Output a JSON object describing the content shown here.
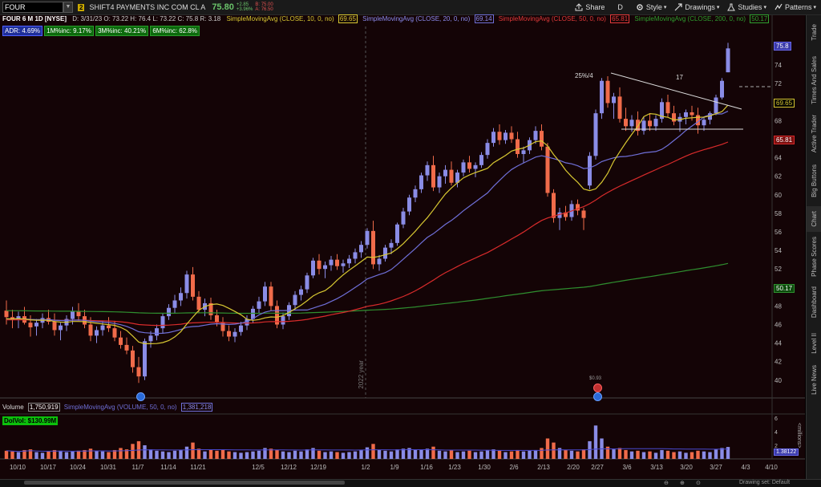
{
  "toolbar": {
    "symbol": "FOUR",
    "link_badge": "2",
    "company": "SHIFT4 PAYMENTS INC COM CL A",
    "last_price": "75.80",
    "change_top": "+2.85",
    "change_bottom": "+3.96%",
    "bid": "B: 75.00",
    "ask": "A: 76.50",
    "share_label": "Share",
    "period_label": "D",
    "style_label": "Style",
    "drawings_label": "Drawings",
    "studies_label": "Studies",
    "patterns_label": "Patterns"
  },
  "header": {
    "title": "FOUR 6 M 1D [NYSE]",
    "ohlc": "D: 3/31/23  O: 73.22  H: 76.4  L: 73.22  C: 75.8  R: 3.18",
    "sma10_label": "SimpleMovingAvg (CLOSE, 10, 0, no)",
    "sma10_value": "69.65",
    "sma20_label": "SimpleMovingAvg (CLOSE, 20, 0, no)",
    "sma20_value": "69.14",
    "sma50_label": "SimpleMovingAvg (CLOSE, 50, 0, no)",
    "sma50_value": "65.81",
    "sma200_label": "SimpleMovingAvg (CLOSE, 200, 0, no)",
    "sma200_value": "50.17"
  },
  "badges": {
    "adr": "ADR: 4.69%",
    "m1": "1M%inc: 9.17%",
    "m3": "3M%inc: 40.21%",
    "m6": "6M%inc: 62.8%",
    "dolvol": "DolVol: $130.99M"
  },
  "volume_header": {
    "label": "Volume",
    "value": "1,750,919",
    "sma_label": "SimpleMovingAvg (VOLUME, 50, 0, no)",
    "sma_value": "1,381,218"
  },
  "annotations": {
    "pattern_left": "25%/4",
    "pattern_right": "17",
    "year": "2022 year",
    "earnings_small": "$0.93"
  },
  "price_axis": [
    "76",
    "74",
    "72",
    "70",
    "68",
    "66",
    "64",
    "62",
    "60",
    "58",
    "56",
    "54",
    "52",
    "50",
    "48",
    "46",
    "44",
    "42",
    "40"
  ],
  "price_tags": {
    "last": "75.8",
    "sma10": "69.65",
    "sma50": "65.81",
    "sma200": "50.17"
  },
  "volume_axis": [
    "6",
    "4",
    "2"
  ],
  "volume_unit": "<millions>",
  "volume_tag": "1.38122",
  "date_axis": [
    "10/10",
    "10/17",
    "10/24",
    "10/31",
    "11/7",
    "11/14",
    "11/21",
    "12/5",
    "12/12",
    "12/19",
    "1/2",
    "1/9",
    "1/16",
    "1/23",
    "1/30",
    "2/6",
    "2/13",
    "2/20",
    "2/27",
    "3/6",
    "3/13",
    "3/20",
    "3/27",
    "4/3",
    "4/10"
  ],
  "right_tabs": [
    "Trade",
    "Times And Sales",
    "Active Trader",
    "Big Buttons",
    "Chart",
    "Phase Scores",
    "Dashboard",
    "Level II",
    "Live News"
  ],
  "bottom_status": "Drawing set: Default",
  "colors": {
    "up": "#8a8ce6",
    "down": "#f06b4a",
    "sma10": "#d8c832",
    "sma20": "#6f6fd8",
    "sma50": "#d82b2b",
    "sma200": "#2f8f2f",
    "background": "#140406"
  },
  "candles": [
    [
      47.5,
      48.6,
      46.0,
      46.8
    ],
    [
      46.8,
      47.6,
      45.6,
      46.5
    ],
    [
      46.5,
      47.4,
      45.6,
      46.9
    ],
    [
      46.9,
      47.9,
      46.0,
      46.2
    ],
    [
      46.2,
      47.0,
      44.7,
      45.7
    ],
    [
      45.8,
      46.6,
      44.8,
      46.2
    ],
    [
      46.2,
      47.2,
      45.6,
      46.7
    ],
    [
      46.7,
      47.6,
      46.0,
      46.3
    ],
    [
      46.3,
      47.2,
      44.8,
      45.4
    ],
    [
      45.4,
      46.2,
      44.3,
      45.9
    ],
    [
      45.9,
      47.0,
      45.3,
      46.6
    ],
    [
      46.6,
      47.9,
      46.0,
      47.4
    ],
    [
      47.4,
      48.3,
      46.4,
      46.9
    ],
    [
      46.9,
      47.6,
      45.6,
      46.0
    ],
    [
      46.0,
      46.8,
      44.2,
      44.8
    ],
    [
      44.8,
      45.8,
      44.0,
      45.4
    ],
    [
      45.4,
      46.4,
      44.8,
      45.9
    ],
    [
      45.9,
      46.8,
      45.2,
      45.6
    ],
    [
      45.6,
      46.4,
      44.2,
      44.6
    ],
    [
      44.6,
      45.3,
      43.4,
      43.8
    ],
    [
      43.8,
      44.6,
      42.8,
      43.2
    ],
    [
      43.2,
      43.7,
      40.8,
      41.4
    ],
    [
      41.4,
      42.5,
      39.7,
      40.4
    ],
    [
      40.4,
      44.5,
      40.0,
      44.2
    ],
    [
      44.2,
      45.3,
      43.5,
      44.8
    ],
    [
      44.8,
      46.0,
      44.3,
      45.6
    ],
    [
      45.6,
      47.2,
      45.0,
      46.9
    ],
    [
      46.9,
      48.2,
      46.5,
      47.8
    ],
    [
      47.8,
      49.2,
      47.2,
      48.6
    ],
    [
      48.6,
      50.0,
      48.0,
      49.4
    ],
    [
      49.4,
      51.8,
      48.8,
      51.4
    ],
    [
      51.4,
      52.2,
      48.6,
      49.0
    ],
    [
      49.0,
      49.6,
      47.2,
      47.6
    ],
    [
      47.6,
      48.8,
      46.9,
      48.3
    ],
    [
      48.3,
      48.9,
      46.5,
      47.0
    ],
    [
      47.0,
      47.6,
      45.8,
      46.2
    ],
    [
      46.2,
      46.8,
      44.7,
      45.3
    ],
    [
      45.3,
      45.9,
      44.2,
      44.7
    ],
    [
      44.7,
      45.6,
      44.1,
      45.2
    ],
    [
      45.2,
      46.3,
      44.8,
      45.9
    ],
    [
      45.9,
      47.0,
      45.4,
      46.6
    ],
    [
      46.6,
      48.0,
      46.2,
      47.7
    ],
    [
      47.7,
      49.0,
      47.2,
      48.5
    ],
    [
      48.5,
      50.6,
      48.0,
      50.1
    ],
    [
      50.1,
      50.6,
      47.5,
      48.0
    ],
    [
      48.0,
      48.6,
      45.6,
      46.0
    ],
    [
      46.0,
      47.3,
      45.5,
      46.9
    ],
    [
      46.9,
      48.4,
      46.5,
      48.1
    ],
    [
      48.1,
      49.6,
      47.6,
      49.2
    ],
    [
      49.2,
      50.2,
      48.6,
      49.8
    ],
    [
      49.8,
      51.6,
      49.4,
      51.3
    ],
    [
      51.3,
      53.2,
      51.0,
      52.9
    ],
    [
      52.9,
      53.6,
      51.4,
      52.0
    ],
    [
      52.0,
      52.8,
      51.0,
      52.4
    ],
    [
      52.4,
      53.4,
      51.8,
      53.0
    ],
    [
      53.0,
      53.6,
      51.9,
      52.3
    ],
    [
      52.3,
      53.0,
      51.6,
      52.6
    ],
    [
      52.6,
      53.5,
      52.1,
      53.1
    ],
    [
      53.1,
      54.2,
      52.6,
      53.8
    ],
    [
      53.8,
      55.0,
      53.2,
      54.6
    ],
    [
      54.6,
      56.4,
      54.2,
      56.1
    ],
    [
      56.1,
      57.2,
      52.0,
      52.5
    ],
    [
      52.5,
      53.5,
      51.8,
      53.1
    ],
    [
      53.1,
      54.6,
      52.8,
      54.3
    ],
    [
      54.3,
      55.2,
      53.6,
      54.8
    ],
    [
      54.8,
      57.0,
      54.5,
      56.8
    ],
    [
      56.8,
      58.6,
      56.4,
      58.2
    ],
    [
      58.2,
      60.0,
      57.8,
      59.7
    ],
    [
      59.7,
      61.0,
      59.2,
      60.6
    ],
    [
      60.6,
      62.4,
      60.2,
      62.1
    ],
    [
      62.1,
      63.6,
      61.5,
      63.2
    ],
    [
      63.2,
      64.2,
      60.4,
      60.8
    ],
    [
      60.8,
      62.4,
      60.2,
      62.0
    ],
    [
      62.0,
      63.2,
      61.2,
      62.7
    ],
    [
      62.7,
      63.6,
      61.0,
      61.3
    ],
    [
      61.3,
      62.7,
      60.8,
      62.4
    ],
    [
      62.4,
      63.8,
      62.0,
      63.5
    ],
    [
      63.5,
      64.2,
      62.4,
      62.8
    ],
    [
      62.8,
      63.5,
      61.9,
      63.2
    ],
    [
      63.2,
      64.6,
      62.9,
      64.3
    ],
    [
      64.3,
      66.0,
      63.9,
      65.6
    ],
    [
      65.6,
      67.2,
      65.2,
      66.8
    ],
    [
      66.8,
      67.6,
      65.4,
      65.9
    ],
    [
      65.9,
      67.0,
      65.5,
      66.7
    ],
    [
      66.7,
      67.4,
      65.6,
      66.0
    ],
    [
      66.0,
      66.8,
      64.0,
      64.4
    ],
    [
      64.4,
      65.2,
      63.4,
      64.8
    ],
    [
      64.8,
      66.2,
      64.4,
      65.9
    ],
    [
      65.9,
      67.4,
      65.5,
      66.9
    ],
    [
      66.9,
      67.6,
      64.8,
      65.2
    ],
    [
      65.2,
      65.6,
      59.8,
      60.2
    ],
    [
      60.2,
      60.6,
      57.0,
      57.5
    ],
    [
      57.5,
      58.6,
      56.2,
      58.1
    ],
    [
      58.1,
      58.8,
      57.2,
      57.6
    ],
    [
      57.6,
      59.4,
      57.2,
      59.0
    ],
    [
      59.0,
      59.5,
      57.8,
      58.3
    ],
    [
      58.3,
      58.6,
      56.2,
      57.5
    ],
    [
      61.0,
      64.6,
      60.6,
      64.2
    ],
    [
      64.2,
      69.2,
      63.8,
      68.8
    ],
    [
      68.8,
      72.6,
      68.2,
      72.3
    ],
    [
      72.3,
      72.8,
      69.4,
      69.9
    ],
    [
      69.9,
      71.0,
      68.2,
      70.6
    ],
    [
      70.6,
      71.6,
      67.8,
      68.2
    ],
    [
      68.2,
      69.4,
      66.9,
      67.4
    ],
    [
      67.4,
      68.6,
      66.8,
      68.1
    ],
    [
      68.1,
      69.0,
      66.4,
      66.9
    ],
    [
      66.9,
      68.4,
      66.5,
      68.0
    ],
    [
      68.0,
      68.8,
      66.9,
      67.4
    ],
    [
      67.4,
      68.6,
      66.9,
      68.2
    ],
    [
      68.2,
      70.4,
      67.8,
      70.0
    ],
    [
      70.0,
      70.8,
      68.4,
      68.8
    ],
    [
      68.8,
      69.6,
      67.5,
      67.9
    ],
    [
      67.9,
      68.8,
      66.8,
      68.4
    ],
    [
      68.4,
      69.2,
      67.6,
      68.9
    ],
    [
      68.9,
      69.6,
      68.0,
      68.6
    ],
    [
      68.6,
      69.4,
      66.6,
      67.5
    ],
    [
      67.5,
      68.4,
      66.9,
      68.1
    ],
    [
      68.1,
      69.0,
      67.6,
      68.8
    ],
    [
      68.8,
      70.8,
      68.6,
      70.5
    ],
    [
      70.5,
      72.6,
      70.3,
      72.3
    ],
    [
      73.22,
      76.4,
      73.22,
      75.8
    ]
  ],
  "volumes": [
    1.2,
    1.1,
    1.0,
    1.3,
    1.4,
    1.0,
    0.9,
    1.1,
    1.3,
    1.2,
    1.0,
    1.1,
    1.2,
    1.3,
    1.5,
    1.2,
    1.1,
    1.0,
    1.3,
    1.6,
    1.4,
    2.2,
    2.6,
    2.0,
    1.4,
    1.2,
    1.1,
    1.0,
    1.2,
    1.3,
    1.8,
    2.4,
    1.5,
    1.1,
    1.3,
    1.2,
    1.4,
    1.1,
    1.0,
    0.9,
    1.0,
    1.1,
    1.2,
    1.6,
    1.5,
    1.3,
    1.1,
    1.0,
    1.2,
    1.1,
    1.4,
    1.6,
    1.2,
    1.0,
    1.1,
    1.0,
    0.9,
    1.0,
    1.1,
    1.3,
    1.7,
    2.2,
    1.3,
    1.2,
    1.1,
    1.4,
    1.5,
    1.6,
    1.3,
    1.4,
    1.5,
    1.8,
    1.2,
    1.1,
    1.3,
    1.0,
    1.1,
    1.2,
    1.0,
    1.1,
    1.3,
    1.4,
    1.2,
    1.0,
    1.1,
    1.3,
    1.1,
    1.2,
    1.3,
    1.6,
    3.0,
    2.4,
    1.6,
    1.3,
    1.2,
    1.1,
    1.4,
    2.6,
    4.9,
    3.0,
    1.8,
    1.4,
    1.6,
    1.3,
    1.1,
    1.2,
    1.0,
    1.1,
    0.9,
    1.3,
    1.2,
    1.0,
    1.1,
    0.9,
    1.0,
    1.2,
    1.1,
    1.0,
    1.4,
    1.6,
    1.75
  ]
}
